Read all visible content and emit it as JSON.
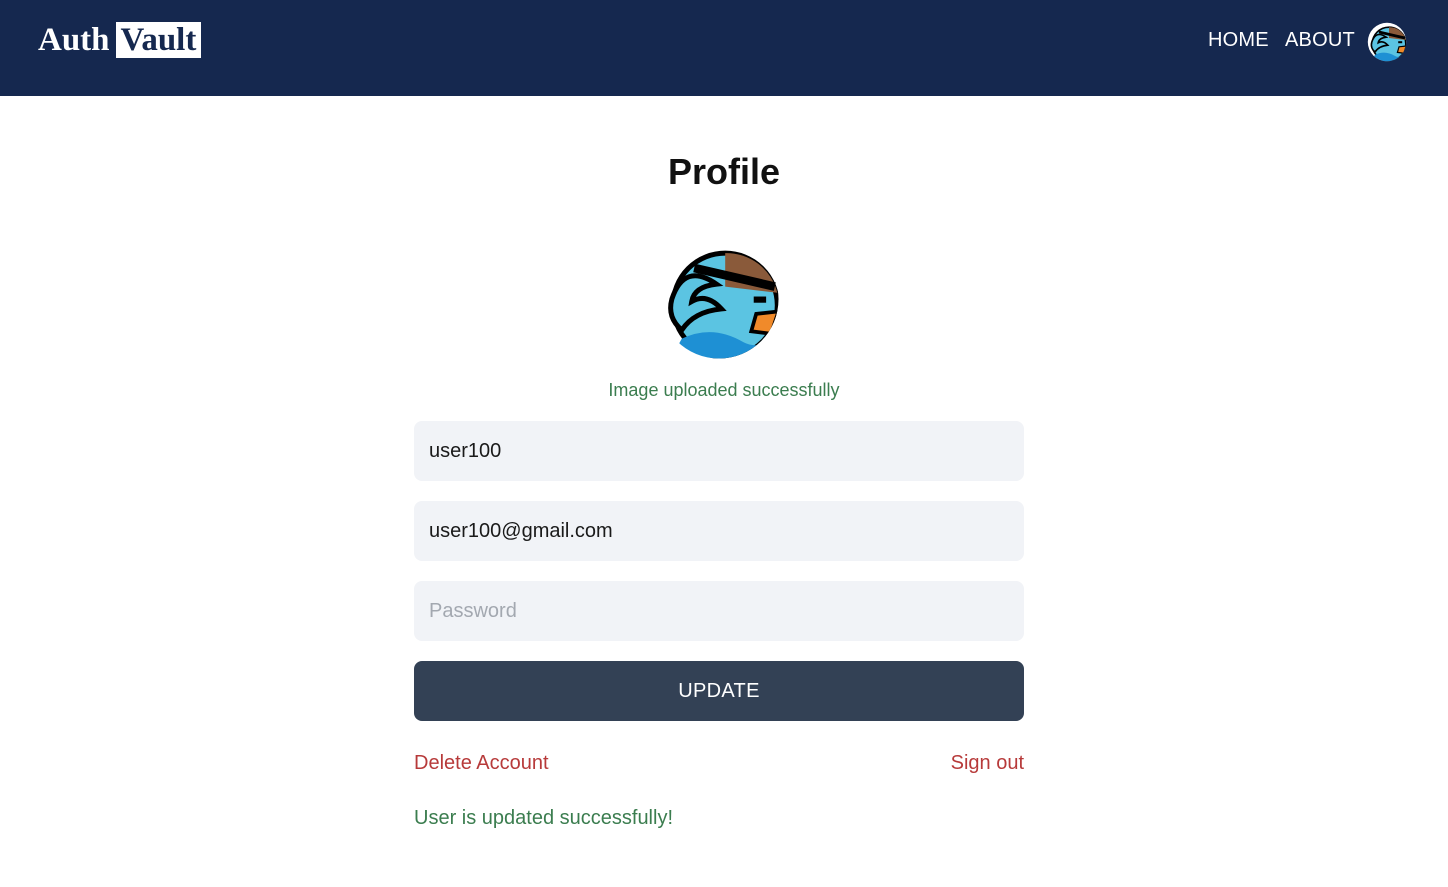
{
  "navbar": {
    "logo_part1": "Auth",
    "logo_part2": "Vault",
    "links": [
      {
        "label": "HOME"
      },
      {
        "label": "ABOUT"
      }
    ],
    "avatar_icon": "blue-bird-avatar-icon"
  },
  "profile": {
    "title": "Profile",
    "avatar_icon": "blue-bird-avatar-icon",
    "upload_status": "Image uploaded successfully",
    "username": {
      "value": "user100"
    },
    "email": {
      "value": "user100@gmail.com"
    },
    "password": {
      "value": "",
      "placeholder": "Password"
    },
    "update_label": "UPDATE",
    "delete_label": "Delete Account",
    "signout_label": "Sign out",
    "update_status": "User is updated successfully!"
  },
  "colors": {
    "navbar_bg": "#15284f",
    "button_bg": "#334155",
    "danger": "#b73a3a",
    "success": "#3b7d4f",
    "field_bg": "#f1f3f7"
  }
}
